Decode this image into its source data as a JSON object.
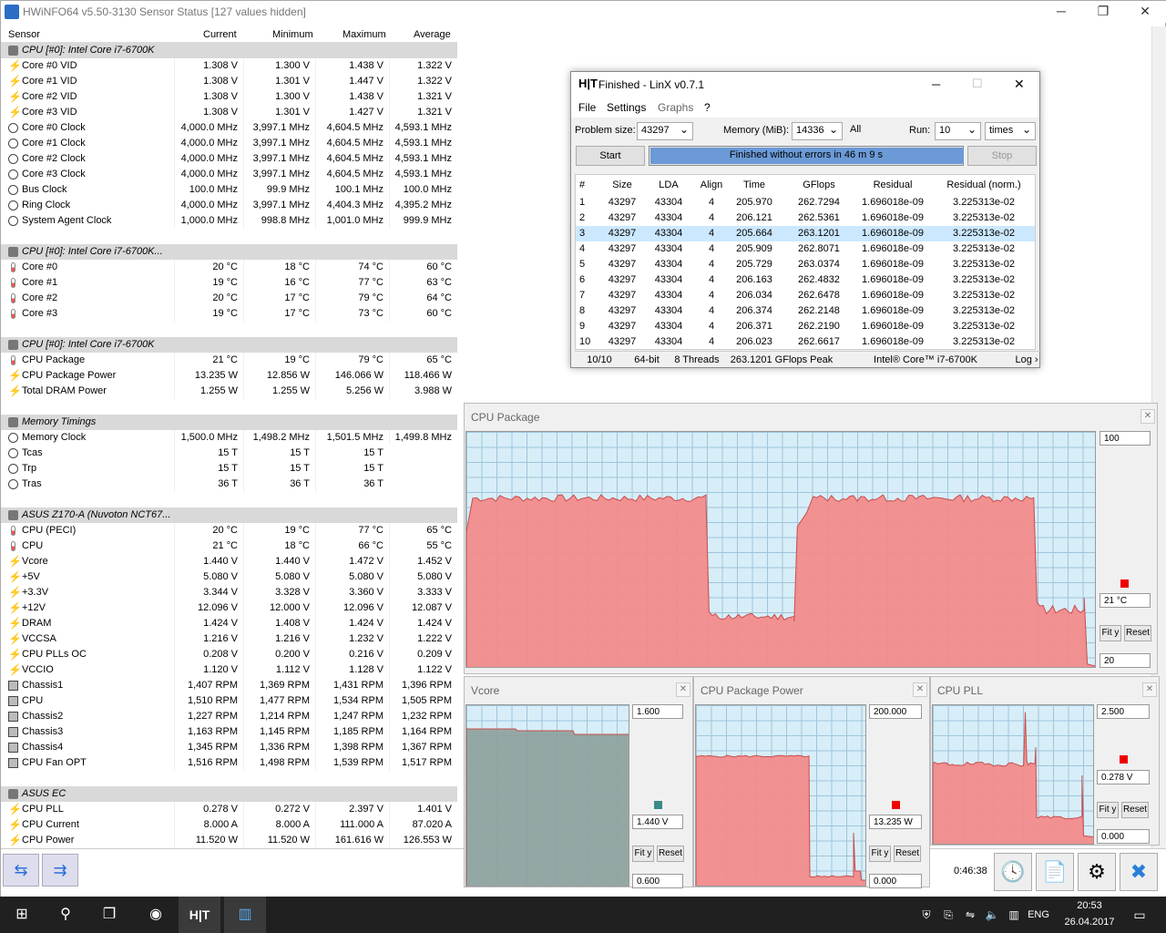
{
  "hwinfo": {
    "title": "HWiNFO64 v5.50-3130 Sensor Status [127 values hidden]",
    "columns": [
      "Sensor",
      "Current",
      "Minimum",
      "Maximum",
      "Average"
    ],
    "sections": [
      {
        "name": "CPU [#0]: Intel Core i7-6700K",
        "rows": [
          {
            "icon": "voltage",
            "name": "Core #0 VID",
            "cur": "1.308 V",
            "min": "1.300 V",
            "max": "1.438 V",
            "avg": "1.322 V"
          },
          {
            "icon": "voltage",
            "name": "Core #1 VID",
            "cur": "1.308 V",
            "min": "1.301 V",
            "max": "1.447 V",
            "avg": "1.322 V"
          },
          {
            "icon": "voltage",
            "name": "Core #2 VID",
            "cur": "1.308 V",
            "min": "1.300 V",
            "max": "1.438 V",
            "avg": "1.321 V"
          },
          {
            "icon": "voltage",
            "name": "Core #3 VID",
            "cur": "1.308 V",
            "min": "1.301 V",
            "max": "1.427 V",
            "avg": "1.321 V"
          },
          {
            "icon": "clock",
            "name": "Core #0 Clock",
            "cur": "4,000.0 MHz",
            "min": "3,997.1 MHz",
            "max": "4,604.5 MHz",
            "avg": "4,593.1 MHz"
          },
          {
            "icon": "clock",
            "name": "Core #1 Clock",
            "cur": "4,000.0 MHz",
            "min": "3,997.1 MHz",
            "max": "4,604.5 MHz",
            "avg": "4,593.1 MHz"
          },
          {
            "icon": "clock",
            "name": "Core #2 Clock",
            "cur": "4,000.0 MHz",
            "min": "3,997.1 MHz",
            "max": "4,604.5 MHz",
            "avg": "4,593.1 MHz"
          },
          {
            "icon": "clock",
            "name": "Core #3 Clock",
            "cur": "4,000.0 MHz",
            "min": "3,997.1 MHz",
            "max": "4,604.5 MHz",
            "avg": "4,593.1 MHz"
          },
          {
            "icon": "clock",
            "name": "Bus Clock",
            "cur": "100.0 MHz",
            "min": "99.9 MHz",
            "max": "100.1 MHz",
            "avg": "100.0 MHz"
          },
          {
            "icon": "clock",
            "name": "Ring Clock",
            "cur": "4,000.0 MHz",
            "min": "3,997.1 MHz",
            "max": "4,404.3 MHz",
            "avg": "4,395.2 MHz"
          },
          {
            "icon": "clock",
            "name": "System Agent Clock",
            "cur": "1,000.0 MHz",
            "min": "998.8 MHz",
            "max": "1,001.0 MHz",
            "avg": "999.9 MHz"
          }
        ]
      },
      {
        "name": "CPU [#0]: Intel Core i7-6700K...",
        "rows": [
          {
            "icon": "temp",
            "name": "Core #0",
            "cur": "20 °C",
            "min": "18 °C",
            "max": "74 °C",
            "avg": "60 °C"
          },
          {
            "icon": "temp",
            "name": "Core #1",
            "cur": "19 °C",
            "min": "16 °C",
            "max": "77 °C",
            "avg": "63 °C"
          },
          {
            "icon": "temp",
            "name": "Core #2",
            "cur": "20 °C",
            "min": "17 °C",
            "max": "79 °C",
            "avg": "64 °C"
          },
          {
            "icon": "temp",
            "name": "Core #3",
            "cur": "19 °C",
            "min": "17 °C",
            "max": "73 °C",
            "avg": "60 °C"
          }
        ]
      },
      {
        "name": "CPU [#0]: Intel Core i7-6700K",
        "rows": [
          {
            "icon": "temp",
            "name": "CPU Package",
            "cur": "21 °C",
            "min": "19 °C",
            "max": "79 °C",
            "avg": "65 °C"
          },
          {
            "icon": "voltage",
            "name": "CPU Package Power",
            "cur": "13.235 W",
            "min": "12.856 W",
            "max": "146.066 W",
            "avg": "118.466 W"
          },
          {
            "icon": "voltage",
            "name": "Total DRAM Power",
            "cur": "1.255 W",
            "min": "1.255 W",
            "max": "5.256 W",
            "avg": "3.988 W"
          }
        ]
      },
      {
        "name": "Memory Timings",
        "rows": [
          {
            "icon": "clock",
            "name": "Memory Clock",
            "cur": "1,500.0 MHz",
            "min": "1,498.2 MHz",
            "max": "1,501.5 MHz",
            "avg": "1,499.8 MHz"
          },
          {
            "icon": "clock",
            "name": "Tcas",
            "cur": "15 T",
            "min": "15 T",
            "max": "15 T",
            "avg": ""
          },
          {
            "icon": "clock",
            "name": "Trp",
            "cur": "15 T",
            "min": "15 T",
            "max": "15 T",
            "avg": ""
          },
          {
            "icon": "clock",
            "name": "Tras",
            "cur": "36 T",
            "min": "36 T",
            "max": "36 T",
            "avg": ""
          }
        ]
      },
      {
        "name": "ASUS Z170-A (Nuvoton NCT67...",
        "rows": [
          {
            "icon": "temp",
            "name": "CPU (PECI)",
            "cur": "20 °C",
            "min": "19 °C",
            "max": "77 °C",
            "avg": "65 °C"
          },
          {
            "icon": "temp",
            "name": "CPU",
            "cur": "21 °C",
            "min": "18 °C",
            "max": "66 °C",
            "avg": "55 °C"
          },
          {
            "icon": "voltage",
            "name": "Vcore",
            "cur": "1.440 V",
            "min": "1.440 V",
            "max": "1.472 V",
            "avg": "1.452 V"
          },
          {
            "icon": "voltage",
            "name": "+5V",
            "cur": "5.080 V",
            "min": "5.080 V",
            "max": "5.080 V",
            "avg": "5.080 V"
          },
          {
            "icon": "voltage",
            "name": "+3.3V",
            "cur": "3.344 V",
            "min": "3.328 V",
            "max": "3.360 V",
            "avg": "3.333 V"
          },
          {
            "icon": "voltage",
            "name": "+12V",
            "cur": "12.096 V",
            "min": "12.000 V",
            "max": "12.096 V",
            "avg": "12.087 V"
          },
          {
            "icon": "voltage",
            "name": "DRAM",
            "cur": "1.424 V",
            "min": "1.408 V",
            "max": "1.424 V",
            "avg": "1.424 V"
          },
          {
            "icon": "voltage",
            "name": "VCCSA",
            "cur": "1.216 V",
            "min": "1.216 V",
            "max": "1.232 V",
            "avg": "1.222 V"
          },
          {
            "icon": "voltage",
            "name": "CPU PLLs OC",
            "cur": "0.208 V",
            "min": "0.200 V",
            "max": "0.216 V",
            "avg": "0.209 V"
          },
          {
            "icon": "voltage",
            "name": "VCCIO",
            "cur": "1.120 V",
            "min": "1.112 V",
            "max": "1.128 V",
            "avg": "1.122 V"
          },
          {
            "icon": "fan",
            "name": "Chassis1",
            "cur": "1,407 RPM",
            "min": "1,369 RPM",
            "max": "1,431 RPM",
            "avg": "1,396 RPM"
          },
          {
            "icon": "fan",
            "name": "CPU",
            "cur": "1,510 RPM",
            "min": "1,477 RPM",
            "max": "1,534 RPM",
            "avg": "1,505 RPM"
          },
          {
            "icon": "fan",
            "name": "Chassis2",
            "cur": "1,227 RPM",
            "min": "1,214 RPM",
            "max": "1,247 RPM",
            "avg": "1,232 RPM"
          },
          {
            "icon": "fan",
            "name": "Chassis3",
            "cur": "1,163 RPM",
            "min": "1,145 RPM",
            "max": "1,185 RPM",
            "avg": "1,164 RPM"
          },
          {
            "icon": "fan",
            "name": "Chassis4",
            "cur": "1,345 RPM",
            "min": "1,336 RPM",
            "max": "1,398 RPM",
            "avg": "1,367 RPM"
          },
          {
            "icon": "fan",
            "name": "CPU Fan OPT",
            "cur": "1,516 RPM",
            "min": "1,498 RPM",
            "max": "1,539 RPM",
            "avg": "1,517 RPM"
          }
        ]
      },
      {
        "name": "ASUS EC",
        "rows": [
          {
            "icon": "voltage",
            "name": "CPU PLL",
            "cur": "0.278 V",
            "min": "0.272 V",
            "max": "2.397 V",
            "avg": "1.401 V"
          },
          {
            "icon": "voltage",
            "name": "CPU Current",
            "cur": "8.000 A",
            "min": "8.000 A",
            "max": "111.000 A",
            "avg": "87.020 A"
          },
          {
            "icon": "voltage",
            "name": "CPU Power",
            "cur": "11.520 W",
            "min": "11.520 W",
            "max": "161.616 W",
            "avg": "126.553 W"
          }
        ]
      }
    ],
    "elapsed": "0:46:38"
  },
  "linx": {
    "title": "Finished - LinX v0.7.1",
    "logo": "H|T",
    "menu": [
      "File",
      "Settings",
      "Graphs",
      "?"
    ],
    "problem_size_label": "Problem size:",
    "problem_size": "43297",
    "memory_label": "Memory (MiB):",
    "memory": "14336",
    "all_label": "All",
    "run_label": "Run:",
    "run": "10",
    "times": "times",
    "start": "Start",
    "stop": "Stop",
    "status": "Finished without errors in 46 m 9 s",
    "status_progress": 1.0,
    "columns": [
      "#",
      "Size",
      "LDA",
      "Align",
      "Time",
      "GFlops",
      "Residual",
      "Residual (norm.)"
    ],
    "rows": [
      [
        "1",
        "43297",
        "43304",
        "4",
        "205.970",
        "262.7294",
        "1.696018e-09",
        "3.225313e-02"
      ],
      [
        "2",
        "43297",
        "43304",
        "4",
        "206.121",
        "262.5361",
        "1.696018e-09",
        "3.225313e-02"
      ],
      [
        "3",
        "43297",
        "43304",
        "4",
        "205.664",
        "263.1201",
        "1.696018e-09",
        "3.225313e-02"
      ],
      [
        "4",
        "43297",
        "43304",
        "4",
        "205.909",
        "262.8071",
        "1.696018e-09",
        "3.225313e-02"
      ],
      [
        "5",
        "43297",
        "43304",
        "4",
        "205.729",
        "263.0374",
        "1.696018e-09",
        "3.225313e-02"
      ],
      [
        "6",
        "43297",
        "43304",
        "4",
        "206.163",
        "262.4832",
        "1.696018e-09",
        "3.225313e-02"
      ],
      [
        "7",
        "43297",
        "43304",
        "4",
        "206.034",
        "262.6478",
        "1.696018e-09",
        "3.225313e-02"
      ],
      [
        "8",
        "43297",
        "43304",
        "4",
        "206.374",
        "262.2148",
        "1.696018e-09",
        "3.225313e-02"
      ],
      [
        "9",
        "43297",
        "43304",
        "4",
        "206.371",
        "262.2190",
        "1.696018e-09",
        "3.225313e-02"
      ],
      [
        "10",
        "43297",
        "43304",
        "4",
        "206.023",
        "262.6617",
        "1.696018e-09",
        "3.225313e-02"
      ]
    ],
    "selected_row": 2,
    "status_bar": [
      "10/10",
      "64-bit",
      "8 Threads",
      "263.1201 GFlops Peak",
      "Intel® Core™ i7-6700K",
      "Log ›"
    ]
  },
  "graphs": {
    "cpu_package": {
      "title": "CPU Package",
      "max": "100",
      "current": "21 °C",
      "min": "20",
      "fit": "Fit y",
      "reset": "Reset",
      "color": "#f28b8b"
    },
    "vcore": {
      "title": "Vcore",
      "max": "1.600",
      "current": "1.440 V",
      "min": "0.600",
      "fit": "Fit y",
      "reset": "Reset",
      "color": "#8fa3a0"
    },
    "cpu_package_power": {
      "title": "CPU Package Power",
      "max": "200.000",
      "current": "13.235 W",
      "min": "0.000",
      "fit": "Fit y",
      "reset": "Reset",
      "color": "#f28b8b"
    },
    "cpu_pll": {
      "title": "CPU PLL",
      "max": "2.500",
      "current": "0.278 V",
      "min": "0.000",
      "fit": "Fit y",
      "reset": "Reset",
      "color": "#f28b8b"
    }
  },
  "taskbar": {
    "time": "20:53",
    "date": "26.04.2017",
    "lang": "ENG"
  }
}
